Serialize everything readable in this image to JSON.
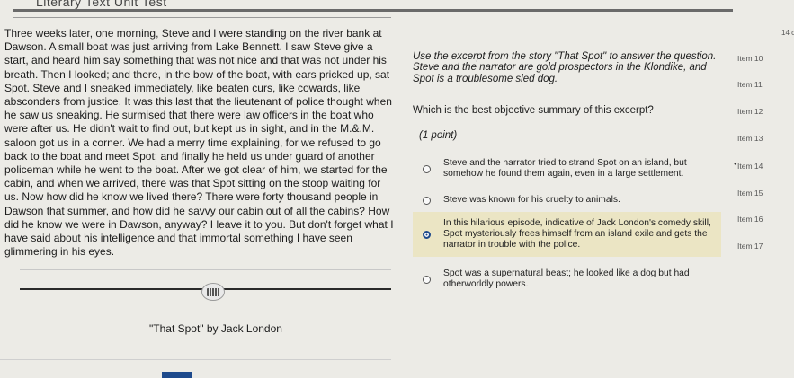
{
  "header": {
    "title": "Literary Text Unit Test"
  },
  "passage": {
    "text": "Three weeks later, one morning, Steve and I were standing on the river bank at Dawson. A small boat was just arriving from Lake Bennett. I saw Steve give a start, and heard him say something that was not nice and that was not under his breath. Then I looked; and there, in the bow of the boat, with ears pricked up, sat Spot. Steve and I sneaked immediately, like beaten curs, like cowards, like absconders from justice. It was this last that the lieutenant of police thought when he saw us sneaking. He surmised that there were law officers in the boat who were after us. He didn't wait to find out, but kept us in sight, and in the M.&.M. saloon got us in a corner. We had a merry time explaining, for we refused to go back to the boat and meet Spot; and finally he held us under guard of another policeman while he went to the boat. After we got clear of him, we started for the cabin, and when we arrived, there was that Spot sitting on the stoop waiting for us. Now how did he know we lived there? There were forty thousand people in Dawson that summer, and how did he savvy our cabin out of all the cabins? How did he know we were in Dawson, anyway? I leave it to you. But don't forget what I have said about his intelligence and that immortal something I have seen glimmering in his eyes.",
    "source": "\"That Spot\" by Jack London"
  },
  "question": {
    "instructions": "Use the excerpt from the story \"That Spot\" to answer the question. Steve and the narrator are gold prospectors in the Klondike, and Spot is a troublesome sled dog.",
    "prompt": "Which is the best objective summary of this excerpt?",
    "points": "(1 point)",
    "options": [
      {
        "text": "Steve and the narrator tried to strand Spot on an island, but somehow he found them again, even in a large settlement."
      },
      {
        "text": "Steve was known for his cruelty to animals."
      },
      {
        "text": "In this hilarious episode, indicative of Jack London's comedy skill, Spot mysteriously frees himself from an island exile and gets the narrator in trouble with the police."
      },
      {
        "text": "Spot was a supernatural beast; he looked like a dog but had otherworldly powers."
      }
    ],
    "selected_index": 2
  },
  "sidebar": {
    "count_label": "14 c",
    "items": [
      {
        "label": "Item 10"
      },
      {
        "label": "Item 11"
      },
      {
        "label": "Item 12"
      },
      {
        "label": "Item 13"
      },
      {
        "label": "Item 14"
      },
      {
        "label": "Item 15"
      },
      {
        "label": "Item 16"
      },
      {
        "label": "Item 17"
      }
    ],
    "current_index": 4
  },
  "colors": {
    "background": "#ecebe6",
    "selected_highlight": "#ebe5c4",
    "accent": "#1e4a8c"
  }
}
